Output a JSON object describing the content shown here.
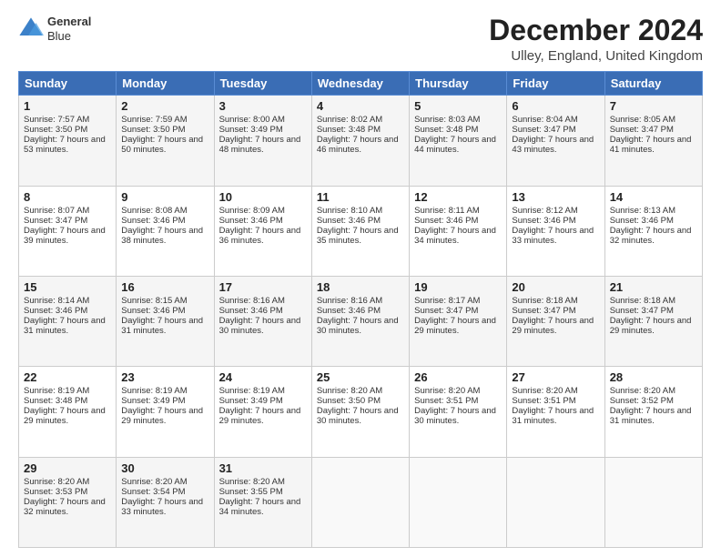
{
  "header": {
    "logo": {
      "line1": "General",
      "line2": "Blue"
    },
    "title": "December 2024",
    "subtitle": "Ulley, England, United Kingdom"
  },
  "calendar": {
    "days": [
      "Sunday",
      "Monday",
      "Tuesday",
      "Wednesday",
      "Thursday",
      "Friday",
      "Saturday"
    ],
    "weeks": [
      [
        null,
        null,
        null,
        null,
        null,
        null,
        null
      ]
    ],
    "cells": {
      "1": {
        "date": "1",
        "sunrise": "7:57 AM",
        "sunset": "3:50 PM",
        "daylight": "7 hours and 53 minutes."
      },
      "2": {
        "date": "2",
        "sunrise": "7:59 AM",
        "sunset": "3:50 PM",
        "daylight": "7 hours and 50 minutes."
      },
      "3": {
        "date": "3",
        "sunrise": "8:00 AM",
        "sunset": "3:49 PM",
        "daylight": "7 hours and 48 minutes."
      },
      "4": {
        "date": "4",
        "sunrise": "8:02 AM",
        "sunset": "3:48 PM",
        "daylight": "7 hours and 46 minutes."
      },
      "5": {
        "date": "5",
        "sunrise": "8:03 AM",
        "sunset": "3:48 PM",
        "daylight": "7 hours and 44 minutes."
      },
      "6": {
        "date": "6",
        "sunrise": "8:04 AM",
        "sunset": "3:47 PM",
        "daylight": "7 hours and 43 minutes."
      },
      "7": {
        "date": "7",
        "sunrise": "8:05 AM",
        "sunset": "3:47 PM",
        "daylight": "7 hours and 41 minutes."
      },
      "8": {
        "date": "8",
        "sunrise": "8:07 AM",
        "sunset": "3:47 PM",
        "daylight": "7 hours and 39 minutes."
      },
      "9": {
        "date": "9",
        "sunrise": "8:08 AM",
        "sunset": "3:46 PM",
        "daylight": "7 hours and 38 minutes."
      },
      "10": {
        "date": "10",
        "sunrise": "8:09 AM",
        "sunset": "3:46 PM",
        "daylight": "7 hours and 36 minutes."
      },
      "11": {
        "date": "11",
        "sunrise": "8:10 AM",
        "sunset": "3:46 PM",
        "daylight": "7 hours and 35 minutes."
      },
      "12": {
        "date": "12",
        "sunrise": "8:11 AM",
        "sunset": "3:46 PM",
        "daylight": "7 hours and 34 minutes."
      },
      "13": {
        "date": "13",
        "sunrise": "8:12 AM",
        "sunset": "3:46 PM",
        "daylight": "7 hours and 33 minutes."
      },
      "14": {
        "date": "14",
        "sunrise": "8:13 AM",
        "sunset": "3:46 PM",
        "daylight": "7 hours and 32 minutes."
      },
      "15": {
        "date": "15",
        "sunrise": "8:14 AM",
        "sunset": "3:46 PM",
        "daylight": "7 hours and 31 minutes."
      },
      "16": {
        "date": "16",
        "sunrise": "8:15 AM",
        "sunset": "3:46 PM",
        "daylight": "7 hours and 31 minutes."
      },
      "17": {
        "date": "17",
        "sunrise": "8:16 AM",
        "sunset": "3:46 PM",
        "daylight": "7 hours and 30 minutes."
      },
      "18": {
        "date": "18",
        "sunrise": "8:16 AM",
        "sunset": "3:46 PM",
        "daylight": "7 hours and 30 minutes."
      },
      "19": {
        "date": "19",
        "sunrise": "8:17 AM",
        "sunset": "3:47 PM",
        "daylight": "7 hours and 29 minutes."
      },
      "20": {
        "date": "20",
        "sunrise": "8:18 AM",
        "sunset": "3:47 PM",
        "daylight": "7 hours and 29 minutes."
      },
      "21": {
        "date": "21",
        "sunrise": "8:18 AM",
        "sunset": "3:47 PM",
        "daylight": "7 hours and 29 minutes."
      },
      "22": {
        "date": "22",
        "sunrise": "8:19 AM",
        "sunset": "3:48 PM",
        "daylight": "7 hours and 29 minutes."
      },
      "23": {
        "date": "23",
        "sunrise": "8:19 AM",
        "sunset": "3:49 PM",
        "daylight": "7 hours and 29 minutes."
      },
      "24": {
        "date": "24",
        "sunrise": "8:19 AM",
        "sunset": "3:49 PM",
        "daylight": "7 hours and 29 minutes."
      },
      "25": {
        "date": "25",
        "sunrise": "8:20 AM",
        "sunset": "3:50 PM",
        "daylight": "7 hours and 30 minutes."
      },
      "26": {
        "date": "26",
        "sunrise": "8:20 AM",
        "sunset": "3:51 PM",
        "daylight": "7 hours and 30 minutes."
      },
      "27": {
        "date": "27",
        "sunrise": "8:20 AM",
        "sunset": "3:51 PM",
        "daylight": "7 hours and 31 minutes."
      },
      "28": {
        "date": "28",
        "sunrise": "8:20 AM",
        "sunset": "3:52 PM",
        "daylight": "7 hours and 31 minutes."
      },
      "29": {
        "date": "29",
        "sunrise": "8:20 AM",
        "sunset": "3:53 PM",
        "daylight": "7 hours and 32 minutes."
      },
      "30": {
        "date": "30",
        "sunrise": "8:20 AM",
        "sunset": "3:54 PM",
        "daylight": "7 hours and 33 minutes."
      },
      "31": {
        "date": "31",
        "sunrise": "8:20 AM",
        "sunset": "3:55 PM",
        "daylight": "7 hours and 34 minutes."
      }
    }
  }
}
